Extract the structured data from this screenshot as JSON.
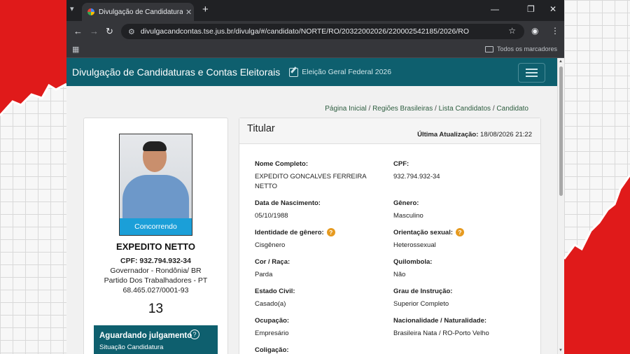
{
  "browser": {
    "tab_title": "Divulgação de Candidaturas e C",
    "url": "divulgacandcontas.tse.jus.br/divulga/#/candidato/NORTE/RO/2032200202​6/220002542185/2026/RO",
    "all_bookmarks": "Todos os marcadores"
  },
  "header": {
    "brand": "Divulgação de Candidaturas e Contas Eleitorais",
    "election": "Eleição Geral Federal 2026"
  },
  "breadcrumb": {
    "items": [
      "Página Inicial",
      "Regiões Brasileiras",
      "Lista Candidatos",
      "Candidato"
    ],
    "separator": "/"
  },
  "candidate_card": {
    "status_badge": "Concorrendo",
    "name": "EXPEDITO NETTO",
    "cpf": "CPF: 932.794.932-34",
    "office": "Governador - Rondônia/ BR",
    "party": "Partido Dos Trabalhadores - PT",
    "cnpj": "68.465.027/0001-93",
    "number": "13",
    "judgment_status": "Aguardando julgamento",
    "judgment_sub": "Situação Candidatura",
    "help_symbol": "?"
  },
  "details": {
    "title": "Titular",
    "updated_label": "Última Atualização:",
    "updated_value": "18/08/2026 21:22",
    "fields": {
      "nome_label": "Nome Completo:",
      "nome_value": "EXPEDITO GONCALVES FERREIRA NETTO",
      "cpf_label": "CPF:",
      "cpf_value": "932.794.932-34",
      "nasc_label": "Data de Nascimento:",
      "nasc_value": "05/10/1988",
      "genero_label": "Gênero:",
      "genero_value": "Masculino",
      "identidade_label": "Identidade de gênero:",
      "identidade_value": "Cisgênero",
      "orientacao_label": "Orientação sexual:",
      "orientacao_value": "Heterossexual",
      "cor_label": "Cor / Raça:",
      "cor_value": "Parda",
      "quilombola_label": "Quilombola:",
      "quilombola_value": "Não",
      "civil_label": "Estado Civil:",
      "civil_value": "Casado(a)",
      "instrucao_label": "Grau de Instrução:",
      "instrucao_value": "Superior Completo",
      "ocupacao_label": "Ocupação:",
      "ocupacao_value": "Empresário",
      "nacionalidade_label": "Nacionalidade / Naturalidade:",
      "nacionalidade_value": "Brasileira Nata / RO-Porto Velho",
      "coligacao_label": "Coligação:",
      "info_symbol": "?"
    }
  },
  "colors": {
    "header_bg": "#0e5f6e",
    "status_blue": "#1b9fd8",
    "info_orange": "#e69a1f",
    "backdrop_red": "#e01a1a"
  }
}
